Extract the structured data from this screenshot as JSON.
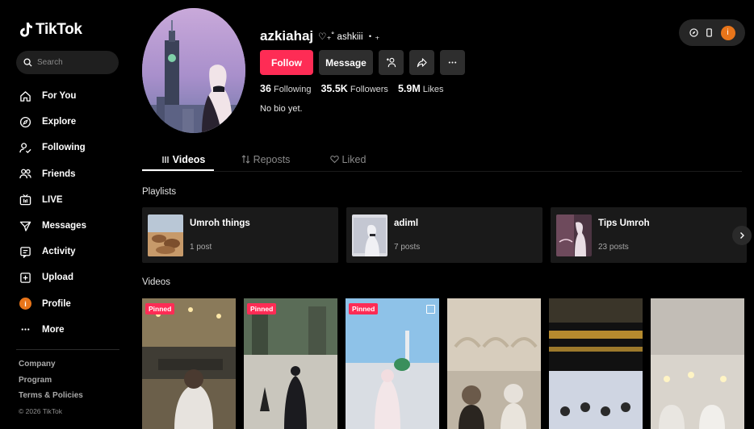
{
  "sidebar": {
    "logo_text": "TikTok",
    "search_placeholder": "Search",
    "items": [
      {
        "label": "For You",
        "icon": "home-icon"
      },
      {
        "label": "Explore",
        "icon": "compass-icon"
      },
      {
        "label": "Following",
        "icon": "following-icon"
      },
      {
        "label": "Friends",
        "icon": "friends-icon"
      },
      {
        "label": "LIVE",
        "icon": "live-icon"
      },
      {
        "label": "Messages",
        "icon": "messages-icon"
      },
      {
        "label": "Activity",
        "icon": "activity-icon"
      },
      {
        "label": "Upload",
        "icon": "upload-icon"
      },
      {
        "label": "Profile",
        "icon": "profile-avatar-icon",
        "avatar_letter": "i"
      },
      {
        "label": "More",
        "icon": "more-icon"
      }
    ],
    "footer": {
      "company": "Company",
      "program": "Program",
      "terms": "Terms & Policies",
      "copyright": "© 2026 TikTok"
    }
  },
  "topbar": {
    "avatar_letter": "i"
  },
  "profile": {
    "username": "azkiahaj",
    "nickname": "♡₊˚ ashkiii ・₊",
    "follow_label": "Follow",
    "message_label": "Message",
    "stats": {
      "following_count": "36",
      "following_label": "Following",
      "followers_count": "35.5K",
      "followers_label": "Followers",
      "likes_count": "5.9M",
      "likes_label": "Likes"
    },
    "bio": "No bio yet."
  },
  "tabs": [
    {
      "label": "Videos",
      "icon": "grid-icon"
    },
    {
      "label": "Reposts",
      "icon": "repost-icon"
    },
    {
      "label": "Liked",
      "icon": "heart-icon"
    }
  ],
  "playlists_title": "Playlists",
  "playlists": [
    {
      "name": "Umroh things",
      "count": "1 post"
    },
    {
      "name": "adiml",
      "count": "7 posts"
    },
    {
      "name": "Tips Umroh",
      "count": "23 posts"
    }
  ],
  "videos_title": "Videos",
  "videos": [
    {
      "badge": "Pinned"
    },
    {
      "badge": "Pinned"
    },
    {
      "badge": "Pinned"
    },
    {
      "badge": ""
    },
    {
      "badge": ""
    },
    {
      "badge": ""
    }
  ],
  "colors": {
    "accent": "#fe2c55",
    "background": "#000000",
    "card": "#1a1a1a",
    "avatar": "#e8751a"
  }
}
